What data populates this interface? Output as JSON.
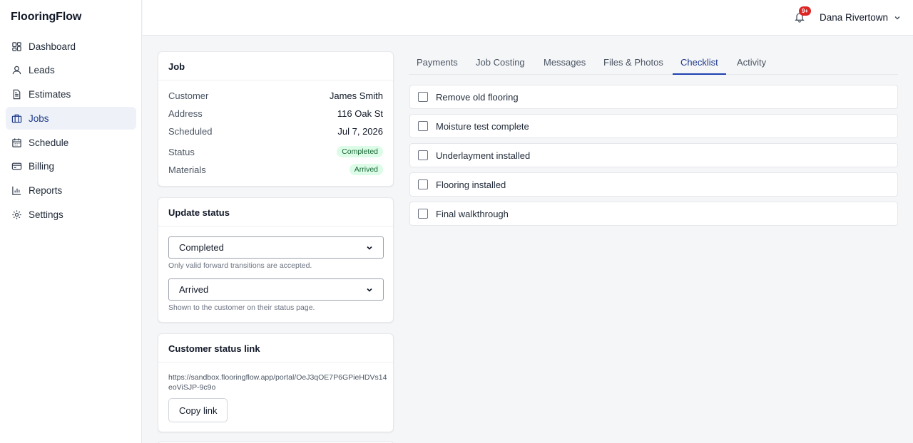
{
  "app": {
    "name": "FlooringFlow"
  },
  "sidebar": {
    "items": [
      {
        "label": "Dashboard",
        "icon": "dashboard-icon"
      },
      {
        "label": "Leads",
        "icon": "user-icon"
      },
      {
        "label": "Estimates",
        "icon": "document-icon"
      },
      {
        "label": "Jobs",
        "icon": "briefcase-icon",
        "active": true
      },
      {
        "label": "Schedule",
        "icon": "calendar-icon"
      },
      {
        "label": "Billing",
        "icon": "credit-card-icon"
      },
      {
        "label": "Reports",
        "icon": "bar-chart-icon"
      },
      {
        "label": "Settings",
        "icon": "gear-icon"
      }
    ]
  },
  "topbar": {
    "notifications_badge": "9+",
    "user_name": "Dana Rivertown"
  },
  "job_card": {
    "title": "Job",
    "customer_label": "Customer",
    "customer_value": "James Smith",
    "address_label": "Address",
    "address_value": "116 Oak St",
    "scheduled_label": "Scheduled",
    "scheduled_value": "Jul 7, 2026",
    "status_label": "Status",
    "status_value": "Completed",
    "materials_label": "Materials",
    "materials_value": "Arrived"
  },
  "update_status": {
    "title": "Update status",
    "status_select_value": "Completed",
    "status_hint": "Only valid forward transitions are accepted.",
    "materials_select_value": "Arrived",
    "materials_hint": "Shown to the customer on their status page."
  },
  "customer_link": {
    "title": "Customer status link",
    "url": "https://sandbox.flooringflow.app/portal/OeJ3qOE7P6GPieHDVs14eoViSJP-9c9o",
    "copy_label": "Copy link"
  },
  "tabs": [
    {
      "label": "Payments"
    },
    {
      "label": "Job Costing"
    },
    {
      "label": "Messages"
    },
    {
      "label": "Files & Photos"
    },
    {
      "label": "Checklist",
      "active": true
    },
    {
      "label": "Activity"
    }
  ],
  "checklist": [
    {
      "label": "Remove old flooring",
      "checked": false
    },
    {
      "label": "Moisture test complete",
      "checked": false
    },
    {
      "label": "Underlayment installed",
      "checked": false
    },
    {
      "label": "Flooring installed",
      "checked": false
    },
    {
      "label": "Final walkthrough",
      "checked": false
    }
  ],
  "colors": {
    "accent": "#1e40af",
    "pill_bg": "#dcfce7",
    "pill_text": "#166534",
    "badge": "#dc2626"
  }
}
